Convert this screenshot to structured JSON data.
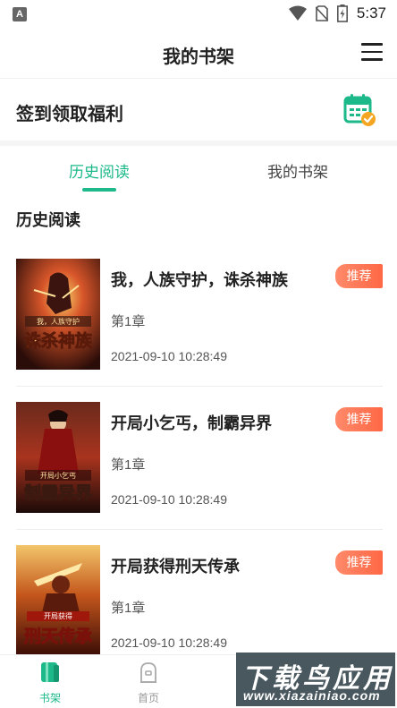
{
  "status_bar": {
    "indicator": "A",
    "time": "5:37",
    "icons": [
      "wifi-icon",
      "no-sim-icon",
      "battery-icon"
    ]
  },
  "header": {
    "title": "我的书架",
    "menu_icon": "hamburger-menu-icon"
  },
  "signin": {
    "label": "签到领取福利",
    "icon": "calendar-check-icon"
  },
  "tabs": [
    {
      "label": "历史阅读",
      "active": true
    },
    {
      "label": "我的书架",
      "active": false
    }
  ],
  "section": {
    "title": "历史阅读"
  },
  "books": [
    {
      "title": "我，人族守护，诛杀神族",
      "chapter": "第1章",
      "time": "2021-09-10 10:28:49",
      "badge": "推荐",
      "cover_text": "诛杀神族",
      "cover_small": "我，人族守护"
    },
    {
      "title": "开局小乞丐，制霸异界",
      "chapter": "第1章",
      "time": "2021-09-10 10:28:49",
      "badge": "推荐",
      "cover_text": "制霸异界",
      "cover_small": "开局小乞丐"
    },
    {
      "title": "开局获得刑天传承",
      "chapter": "第1章",
      "time": "2021-09-10 10:28:49",
      "badge": "推荐",
      "cover_text": "刑天传承",
      "cover_small": "开局获得"
    }
  ],
  "bottom_nav": [
    {
      "label": "书架",
      "icon": "bookshelf-icon",
      "active": true
    },
    {
      "label": "首页",
      "icon": "home-icon",
      "active": false
    }
  ],
  "watermark": {
    "main": "下载鸟应用",
    "sub": "www.xiazainiao.com"
  },
  "colors": {
    "accent": "#1db98a",
    "badge": "#ff6845",
    "icon_orange": "#f5a623"
  }
}
